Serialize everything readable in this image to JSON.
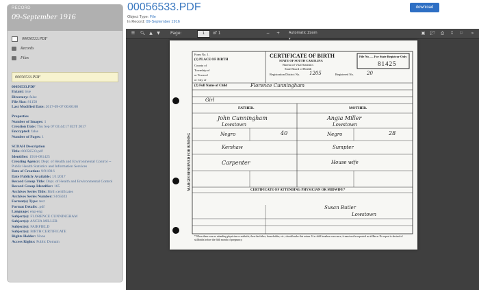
{
  "record": {
    "label": "RECORD",
    "date": "09-September 1916"
  },
  "tree": {
    "file": "00056533.PDF",
    "records": "Records",
    "files": "Files"
  },
  "selected": "00056533.PDF",
  "meta": {
    "name": "00056533.PDF",
    "extant_k": "Extant:",
    "extant_v": "true",
    "directory_k": "Directory:",
    "directory_v": "false",
    "filesize_k": "File Size:",
    "filesize_v": "81158",
    "lastmod_k": "Last Modified Date:",
    "lastmod_v": "2017-09-07 00:00:00",
    "properties": "Properties",
    "numimages_k": "Number of Images:",
    "numimages_v": "1",
    "creation_k": "Creation Date:",
    "creation_v": "Thu Sep 07 03:44:17 EDT 2017",
    "encrypted_k": "Encrypted:",
    "encrypted_v": "false",
    "numpages_k": "Number of Pages:",
    "numpages_v": "1",
    "scdah": "SCDAH Description",
    "title_k": "Title:",
    "title_v": "00056533.pdf",
    "identifier_k": "Identifier:",
    "identifier_v": "1916-081425",
    "agency_k": "Creating Agency:",
    "agency_v": "Dept. of Health and Environmental Control -- Public Health Statistics and Information Services",
    "dateofcreation_k": "Date of Creation:",
    "dateofcreation_v": "9/9/1916",
    "public_k": "Date Publicly Available:",
    "public_v": "1/1/2017",
    "group_k": "Record Group Title:",
    "group_v": "Dept. of Health and Environmental Control",
    "groupid_k": "Record Group Identifier:",
    "groupid_v": "165",
    "series_k": "Archives Series Title:",
    "series_v": "Birth certificates",
    "seriesnum_k": "Archives Series Number:",
    "seriesnum_v": "S165023",
    "format_k": "Format(s) Type:",
    "format_v": "text",
    "formatdetails_k": "Format Details:",
    "formatdetails_v": ".pdf",
    "language_k": "Language:",
    "language_v": "eng-eng",
    "subj1_k": "Subject(s):",
    "subj1_v": "FLORENCE CUNNINGHAM",
    "subj2_k": "Subject(s):",
    "subj2_v": "ANGIA MILLER",
    "subj3_k": "Subject(s):",
    "subj3_v": "FAIRFIELD",
    "subj4_k": "Subject(s):",
    "subj4_v": "BIRTH CERTIFICATE",
    "rights_k": "Rights Holder:",
    "rights_v": "None",
    "access_k": "Access Rights:",
    "access_v": "Public Domain"
  },
  "header": {
    "title": "00056533.PDF",
    "object_type_label": "Object Type:",
    "object_type_value": "File",
    "in_record_label": "In Record:",
    "in_record_value": "09-September 1916",
    "download": "download"
  },
  "viewer": {
    "page_label": "Page:",
    "page_value": "1",
    "page_of": "of 1",
    "zoom": "Automatic Zoom"
  },
  "certificate": {
    "form": "Form No. 1.",
    "place_of_birth": "(1) PLACE OF BIRTH",
    "county_of": "County of",
    "township_of": "Township of",
    "or_town_of": "or Town of",
    "or_city_of": "or City of",
    "title": "CERTIFICATE OF BIRTH",
    "state": "STATE OF SOUTH CAROLINA",
    "bureau": "Bureau of Vital Statistics",
    "board": "State Board of Health",
    "file_no": "File No. — For State Registrar Only",
    "file_number": "81425",
    "registration_district": "Registration District No.",
    "district_no": "1205",
    "registered_no": "Registered No.",
    "registered_value": "20",
    "full_name_label": "(2) Full Name of Child",
    "full_name_value": "Florence Cunningham",
    "sex": "Girl",
    "father": "FATHER.",
    "mother": "MOTHER.",
    "father_name": "John Cunningham",
    "mother_name": "Angia Miller",
    "father_residence": "Lowstown",
    "mother_residence": "Lowstown",
    "father_color": "Negro",
    "mother_color": "Negro",
    "father_age": "40",
    "mother_age": "28",
    "father_birthplace": "Kershaw",
    "mother_birthplace": "Sumpter",
    "father_occupation": "Carpenter",
    "mother_occupation": "House wife",
    "certificate_section": "CERTIFICATE OF ATTENDING PHYSICIAN OR MIDWIFE*",
    "midwife_name": "Susan Butler",
    "midwife_town": "Lowstown",
    "margin_note": "MARGIN RESERVED FOR BINDING",
    "bottom_note": "* When there was no attending physician or midwife, then the father, householder, etc., should make this return. If a child breathes even once, it must not be reported as stillborn. No report is desired of stillbirths before the fifth month of pregnancy."
  }
}
